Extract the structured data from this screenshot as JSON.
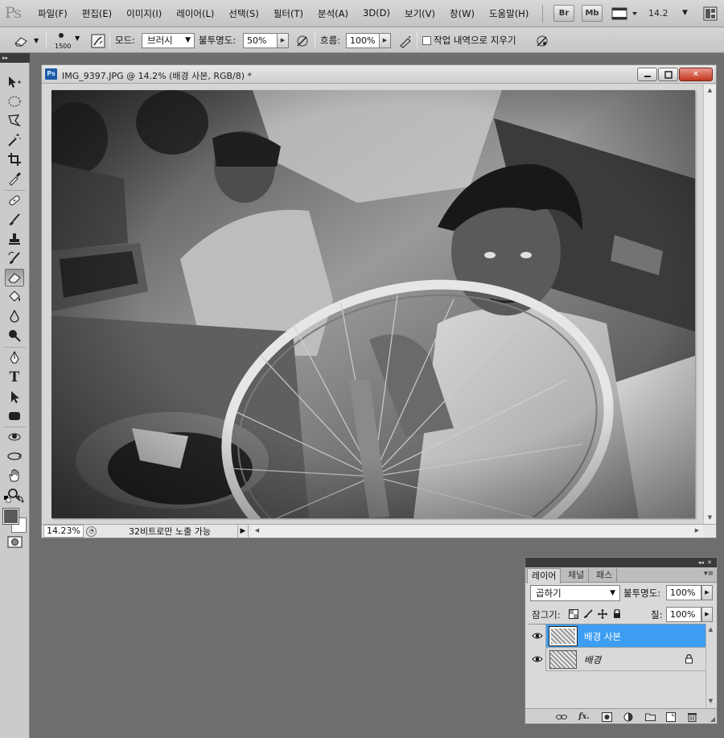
{
  "app": {
    "logo": "Ps",
    "menu": [
      "파일(F)",
      "편집(E)",
      "이미지(I)",
      "레이어(L)",
      "선택(S)",
      "필터(T)",
      "분석(A)",
      "3D(D)",
      "보기(V)",
      "창(W)",
      "도움말(H)"
    ],
    "bridge_button": "Br",
    "minibridge_button": "Mb",
    "zoom_level": "14.2"
  },
  "options_bar": {
    "brush_size": "1500",
    "mode_label": "모드:",
    "mode_value": "브러시",
    "opacity_label": "불투명도:",
    "opacity_value": "50%",
    "flow_label": "흐름:",
    "flow_value": "100%",
    "erase_history_label": "작업 내역으로 지우기"
  },
  "document": {
    "title": "IMG_9397.JPG @ 14.2% (배경 사본, RGB/8) *",
    "status_zoom": "14.23%",
    "status_text": "32비트로만 노출 가능"
  },
  "layers_panel": {
    "tabs": [
      "레이어",
      "채널",
      "패스"
    ],
    "blend_mode": "곱하기",
    "opacity_label": "불투명도:",
    "opacity_value": "100%",
    "lock_label": "잠그기:",
    "fill_label": "칠:",
    "fill_value": "100%",
    "layers": [
      {
        "name": "배경 사본",
        "selected": true,
        "visible": true
      },
      {
        "name": "배경",
        "selected": false,
        "visible": true,
        "locked": true
      }
    ]
  },
  "colors": {
    "selection": "#3d9df2",
    "workspace": "#6e6e6e",
    "panel": "#d9d9d9"
  }
}
